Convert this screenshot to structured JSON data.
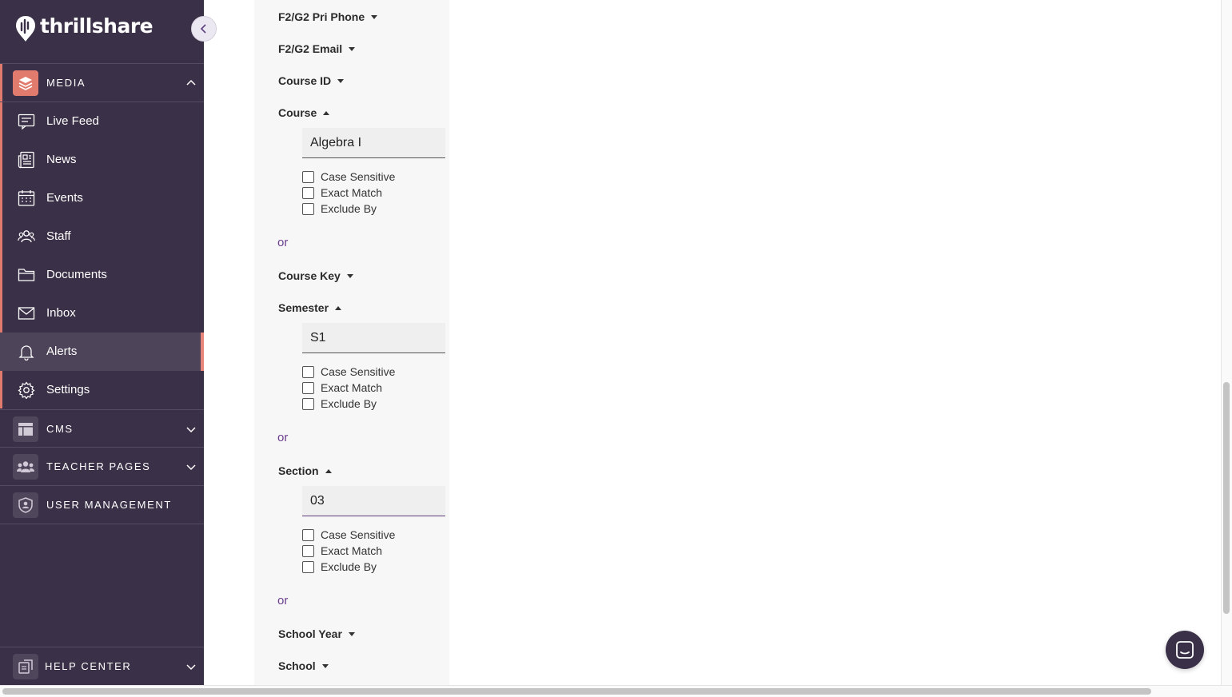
{
  "brand": {
    "name": "thrillshare"
  },
  "sidebar": {
    "media": {
      "label": "MEDIA"
    },
    "items": [
      {
        "label": "Live Feed",
        "icon": "live-feed-icon"
      },
      {
        "label": "News",
        "icon": "news-icon"
      },
      {
        "label": "Events",
        "icon": "calendar-icon"
      },
      {
        "label": "Staff",
        "icon": "staff-icon"
      },
      {
        "label": "Documents",
        "icon": "folder-icon"
      },
      {
        "label": "Inbox",
        "icon": "envelope-icon"
      },
      {
        "label": "Alerts",
        "icon": "bell-icon",
        "active": true
      },
      {
        "label": "Settings",
        "icon": "gear-icon"
      }
    ],
    "cms": {
      "label": "CMS"
    },
    "teacher_pages": {
      "label": "TEACHER PAGES"
    },
    "user_management": {
      "label": "USER MANAGEMENT"
    },
    "help_center": {
      "label": "HELP CENTER"
    }
  },
  "filters": {
    "f2g2_pri_phone": {
      "label": "F2/G2 Pri Phone",
      "expanded": false
    },
    "f2g2_email": {
      "label": "F2/G2 Email",
      "expanded": false
    },
    "course_id": {
      "label": "Course ID",
      "expanded": false
    },
    "course": {
      "label": "Course",
      "expanded": true,
      "value": "Algebra I",
      "options": [
        "Case Sensitive",
        "Exact Match",
        "Exclude By"
      ],
      "or_label": "or"
    },
    "course_key": {
      "label": "Course Key",
      "expanded": false
    },
    "semester": {
      "label": "Semester",
      "expanded": true,
      "value": "S1",
      "options": [
        "Case Sensitive",
        "Exact Match",
        "Exclude By"
      ],
      "or_label": "or"
    },
    "section": {
      "label": "Section",
      "expanded": true,
      "value": "03",
      "options": [
        "Case Sensitive",
        "Exact Match",
        "Exclude By"
      ],
      "or_label": "or"
    },
    "school_year": {
      "label": "School Year",
      "expanded": false
    },
    "school": {
      "label": "School",
      "expanded": false
    }
  },
  "colors": {
    "sidebar_bg": "#3a3047",
    "accent": "#e07b6e",
    "link": "#6b3e8c"
  }
}
